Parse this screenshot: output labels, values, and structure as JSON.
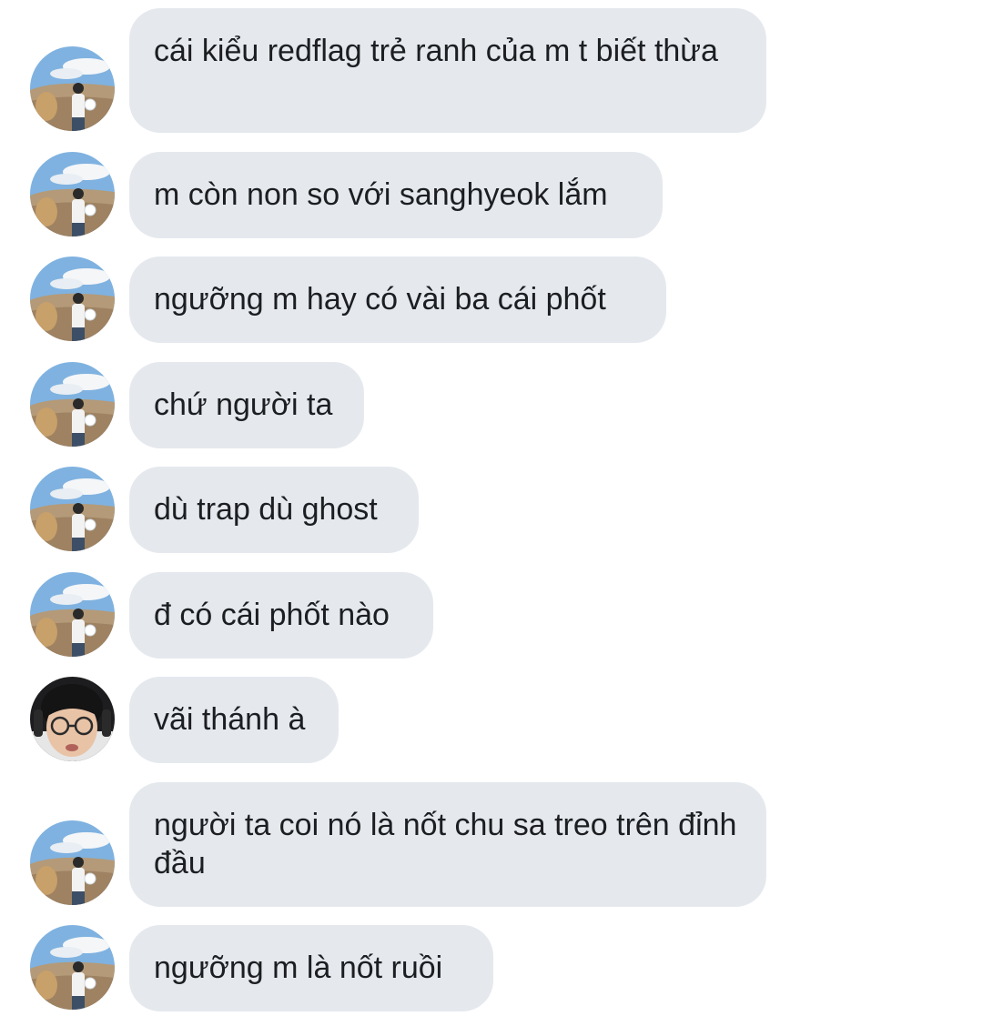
{
  "messages": [
    {
      "sender": "a",
      "text": "cái kiểu redflag trẻ ranh của m t biết thừa"
    },
    {
      "sender": "a",
      "text": "m còn non so với sanghyeok lắm"
    },
    {
      "sender": "a",
      "text": "ngưỡng m hay có vài ba cái phốt"
    },
    {
      "sender": "a",
      "text": "chứ người ta"
    },
    {
      "sender": "a",
      "text": "dù trap dù ghost"
    },
    {
      "sender": "a",
      "text": "đ có cái phốt nào"
    },
    {
      "sender": "b",
      "text": "vãi thánh à"
    },
    {
      "sender": "a",
      "text": "người ta coi nó là nốt chu sa treo trên đỉnh đầu"
    },
    {
      "sender": "a",
      "text": "ngưỡng m là nốt ruồi"
    }
  ],
  "colors": {
    "bubble_bg": "#e5e9ee",
    "text": "#1c1e21",
    "background": "#ffffff"
  },
  "avatars": {
    "a": "landscape-photo-avatar",
    "b": "person-with-glasses-avatar"
  }
}
